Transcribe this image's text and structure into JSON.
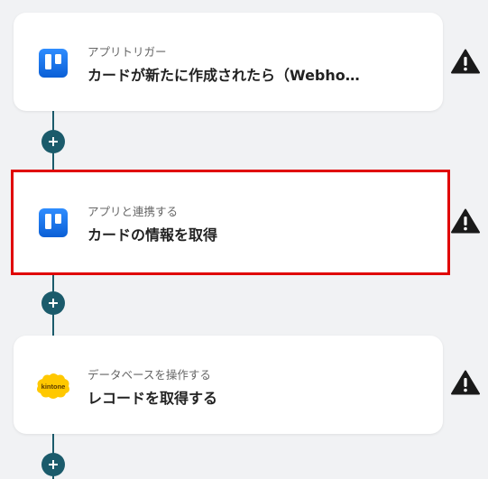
{
  "steps": [
    {
      "app": "Trello",
      "icon": "trello-icon",
      "subtitle": "アプリトリガー",
      "title": "カードが新たに作成されたら（Webho…",
      "selected": false,
      "warning": true
    },
    {
      "app": "Trello",
      "icon": "trello-icon",
      "subtitle": "アプリと連携する",
      "title": "カードの情報を取得",
      "selected": true,
      "warning": true
    },
    {
      "app": "kintone",
      "icon": "kintone-icon",
      "icon_text": "kintone",
      "subtitle": "データベースを操作する",
      "title": "レコードを取得する",
      "selected": false,
      "warning": true
    }
  ],
  "colors": {
    "connector": "#1b5b6b",
    "selected_border": "#e00000",
    "warning": "#1a1a1a",
    "trello": "#0c66e4",
    "kintone": "#ffc800"
  }
}
